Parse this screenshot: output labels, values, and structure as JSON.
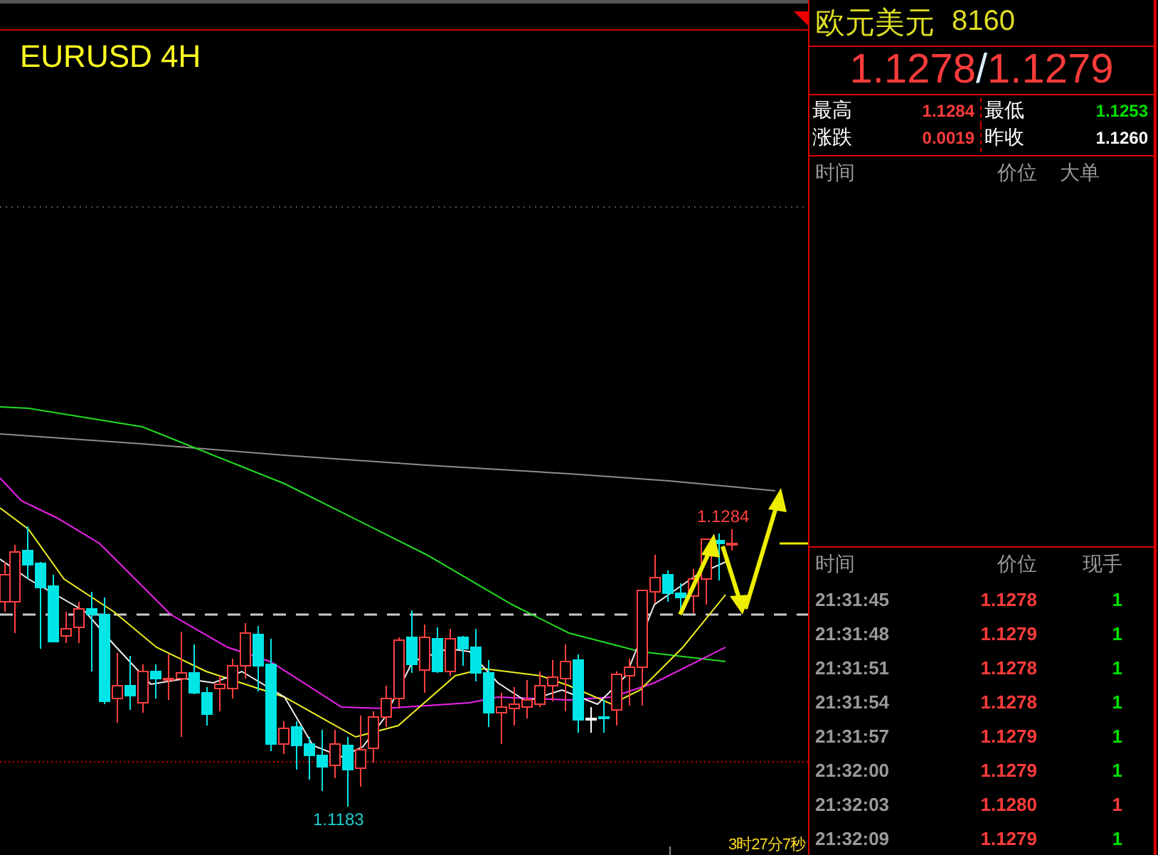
{
  "chart": {
    "title": "EURUSD 4H",
    "high_label": "1.1284",
    "low_label": "1.1183",
    "countdown": "3时27分7秒"
  },
  "quote": {
    "name": "欧元美元",
    "code": "8160",
    "bid": "1.1278",
    "separator": "/",
    "ask": "1.1279"
  },
  "stats": [
    {
      "label": "最高",
      "value": "1.1284",
      "color": "#ff3b3b"
    },
    {
      "label": "最低",
      "value": "1.1253",
      "color": "#00e000"
    },
    {
      "label": "涨跌",
      "value": "0.0019",
      "color": "#ff3b3b"
    },
    {
      "label": "昨收",
      "value": "1.1260",
      "color": "#ffffff"
    }
  ],
  "big_orders": {
    "columns": [
      "时间",
      "价位",
      "大单"
    ]
  },
  "ticks": {
    "columns": [
      "时间",
      "价位",
      "现手"
    ],
    "rows": [
      {
        "time": "21:31:45",
        "price": "1.1278",
        "volume": "1",
        "color": "#00e000"
      },
      {
        "time": "21:31:48",
        "price": "1.1279",
        "volume": "1",
        "color": "#00e000"
      },
      {
        "time": "21:31:51",
        "price": "1.1278",
        "volume": "1",
        "color": "#00e000"
      },
      {
        "time": "21:31:54",
        "price": "1.1278",
        "volume": "1",
        "color": "#00e000"
      },
      {
        "time": "21:31:57",
        "price": "1.1279",
        "volume": "1",
        "color": "#00e000"
      },
      {
        "time": "21:32:00",
        "price": "1.1279",
        "volume": "1",
        "color": "#00e000"
      },
      {
        "time": "21:32:03",
        "price": "1.1280",
        "volume": "1",
        "color": "#ff3b3b"
      },
      {
        "time": "21:32:09",
        "price": "1.1279",
        "volume": "1",
        "color": "#00e000"
      }
    ]
  }
}
